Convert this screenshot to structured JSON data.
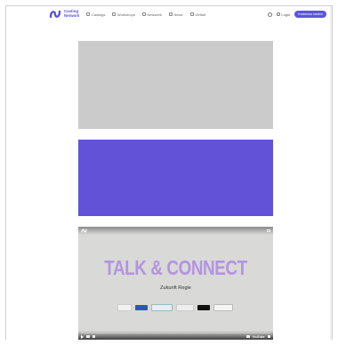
{
  "brand": {
    "line1": "Casting",
    "line2": "Network",
    "color": "#5b54d6"
  },
  "nav": {
    "links": [
      {
        "label": "Castings",
        "icon": "castings-icon"
      },
      {
        "label": "Workshops",
        "icon": "workshops-icon"
      },
      {
        "label": "Netzwerk",
        "icon": "network-icon"
      },
      {
        "label": "News",
        "icon": "news-icon"
      },
      {
        "label": "Vielfalt",
        "icon": "diversity-icon"
      }
    ],
    "login_label": "Login",
    "cta_label": "Kostenlos starten"
  },
  "placeholders": {
    "first_color": "#cbcbcb",
    "second_color": "#6152d8"
  },
  "video": {
    "headline": "TALK & CONNECT",
    "subtitle": "Zukunft Regie",
    "platform": "YouTube",
    "headline_color": "#b394e0",
    "progress": 0
  }
}
